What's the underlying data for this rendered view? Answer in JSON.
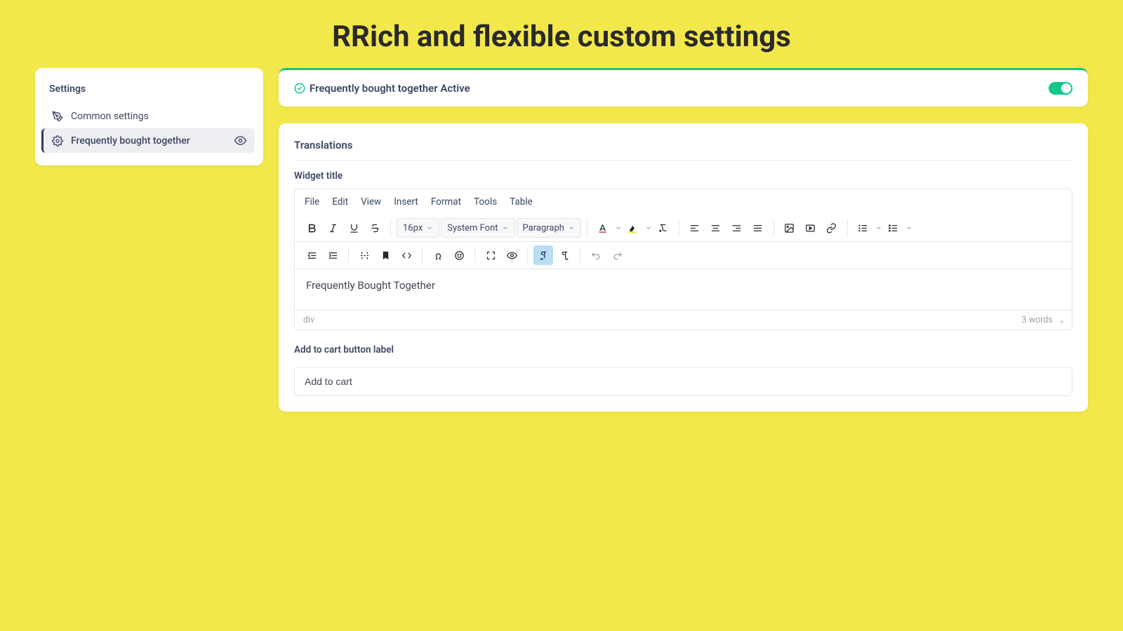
{
  "page": {
    "title": "RRich and flexible custom settings"
  },
  "sidebar": {
    "heading": "Settings",
    "items": [
      {
        "label": "Common settings"
      },
      {
        "label": "Frequently bought together"
      }
    ]
  },
  "status": {
    "text": "Frequently bought together Active",
    "toggle_on": true
  },
  "translations": {
    "section_title": "Translations",
    "widget_title_label": "Widget title",
    "editor": {
      "menubar": [
        "File",
        "Edit",
        "View",
        "Insert",
        "Format",
        "Tools",
        "Table"
      ],
      "font_size": "16px",
      "font_family": "System Font",
      "block_format": "Paragraph",
      "content": "Frequently Bought Together",
      "status_left": "div",
      "status_right": "3 words"
    },
    "add_to_cart_label": "Add to cart button label",
    "add_to_cart_value": "Add to cart"
  }
}
